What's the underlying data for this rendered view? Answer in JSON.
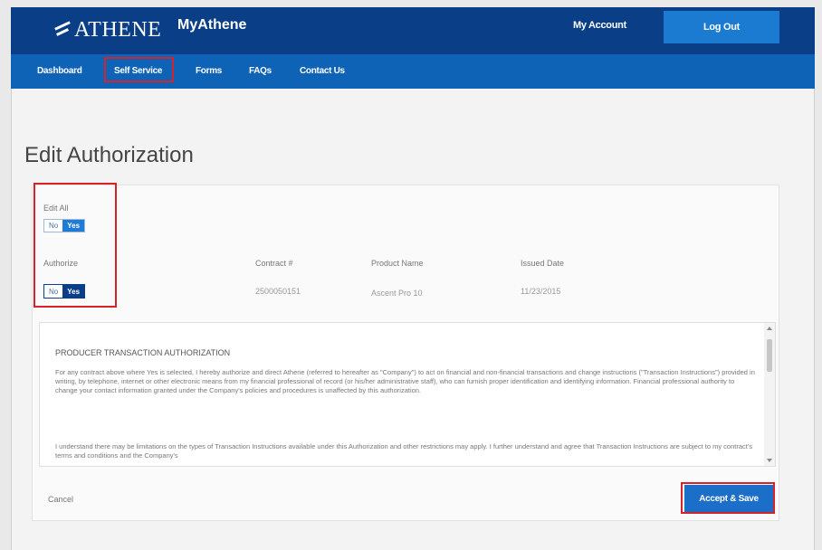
{
  "header": {
    "logo_text": "ATHENE",
    "app_name": "MyAthene",
    "my_account": "My Account",
    "logout": "Log Out"
  },
  "nav": {
    "items": [
      "Dashboard",
      "Self Service",
      "Forms",
      "FAQs",
      "Contact Us"
    ],
    "selected": "Self Service"
  },
  "page": {
    "title": "Edit Authorization"
  },
  "edit_all": {
    "label": "Edit All",
    "no": "No",
    "yes": "Yes",
    "selected": "Yes"
  },
  "table": {
    "headers": [
      "Authorize",
      "Contract #",
      "Product Name",
      "Issued Date"
    ],
    "row": {
      "toggle_no": "No",
      "toggle_yes": "Yes",
      "contract": "2500050151",
      "product": "Ascent Pro 10",
      "issued": "11/23/2015"
    }
  },
  "authorization": {
    "title": "PRODUCER TRANSACTION AUTHORIZATION",
    "para1": "For any contract above where Yes is selected, I hereby authorize and direct Athene (referred to hereafter as \"Company\") to act on financial and non-financial transactions and change instructions (\"Transaction Instructions\") provided in writing, by telephone, internet or other electronic means from my financial professional of record (or his/her administrative staff), who can furnish proper identification and identifying information. Financial professional authority to change your contact information granted under the Company's policies and procedures is unaffected by this authorization.",
    "para2": "I understand there may be limitations on the types of Transaction Instructions available under this Authorization and other restrictions may apply. I further understand and agree that Transaction Instructions are subject to my contract's terms and conditions and the Company's"
  },
  "actions": {
    "cancel": "Cancel",
    "accept": "Accept & Save"
  },
  "colors": {
    "header_bg": "#0a3e87",
    "nav_bg": "#0e63b7",
    "button_blue": "#1b7bd0",
    "highlight_red": "#d5222b",
    "toggle_yes_light": "#1e7bd6",
    "toggle_yes_dark": "#0a3e87"
  }
}
